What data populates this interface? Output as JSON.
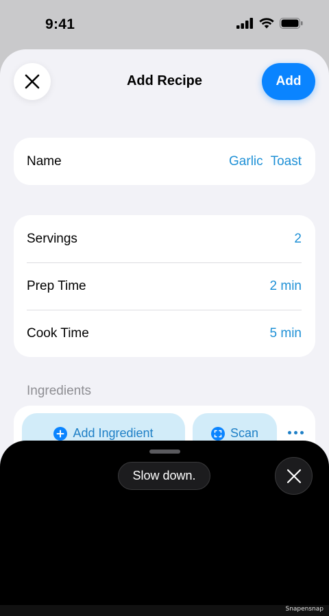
{
  "status_bar": {
    "time": "9:41"
  },
  "header": {
    "title": "Add Recipe",
    "add_label": "Add"
  },
  "name_card": {
    "label": "Name",
    "value": "Garlic Toast"
  },
  "details_card": {
    "rows": [
      {
        "label": "Servings",
        "value": "2"
      },
      {
        "label": "Prep Time",
        "value": "2 min"
      },
      {
        "label": "Cook Time",
        "value": "5 min"
      }
    ]
  },
  "ingredients": {
    "section_label": "Ingredients",
    "add_ingredient_label": "Add Ingredient",
    "scan_label": "Scan"
  },
  "overlay": {
    "toast_text": "Slow down."
  },
  "footer": {
    "watermark": "Snapensnap"
  },
  "colors": {
    "accent": "#0a84ff",
    "value_text": "#1e90d6",
    "pill_bg": "#d2ecf9",
    "sheet_bg": "#f2f2f7"
  }
}
